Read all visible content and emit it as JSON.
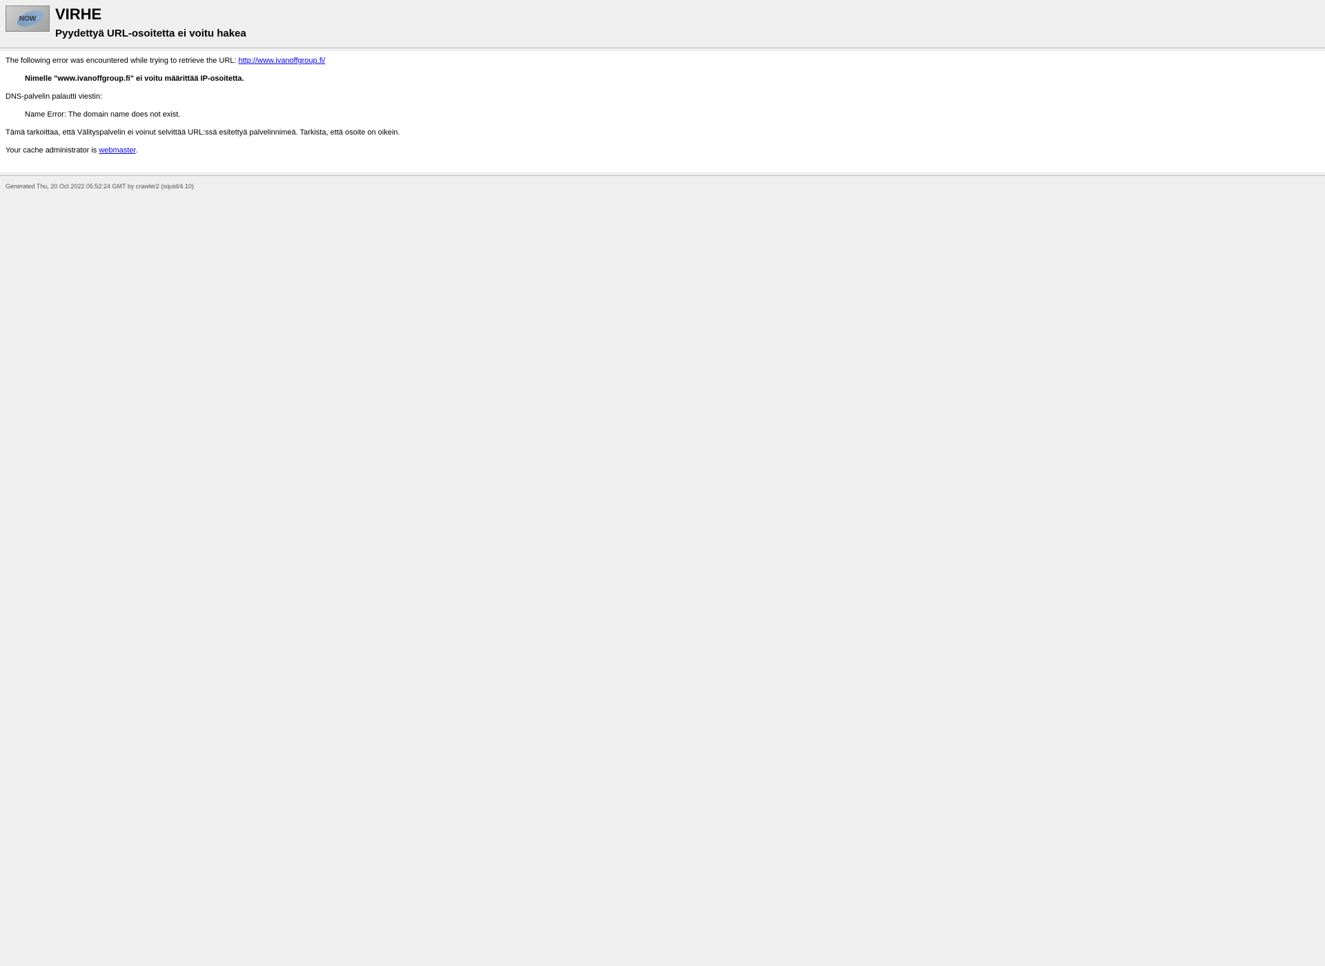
{
  "header": {
    "icon_label": "NOW",
    "title": "VIRHE",
    "subtitle": "Pyydettyä URL-osoitetta ei voitu hakea"
  },
  "content": {
    "intro_prefix": "The following error was encountered while trying to retrieve the URL: ",
    "intro_url": "http://www.ivanoffgroup.fi/",
    "error_bold": "Nimelle \"www.ivanoffgroup.fi\" ei voitu määrittää IP-osoitetta.",
    "dns_message_label": "DNS-palvelin palautti viestin:",
    "dns_error": "Name Error: The domain name does not exist.",
    "explanation": "Tämä tarkoittaa, että Välityspalvelin ei voinut selvittää URL:ssä esitettyä palvelinnimeä. Tarkista, että osoite on oikein.",
    "admin_prefix": "Your cache administrator is ",
    "admin_link": "webmaster",
    "admin_suffix": "."
  },
  "footer": {
    "generated": "Generated Thu, 20 Oct 2022 05:52:24 GMT by crawler2 (squid/4.10)"
  }
}
